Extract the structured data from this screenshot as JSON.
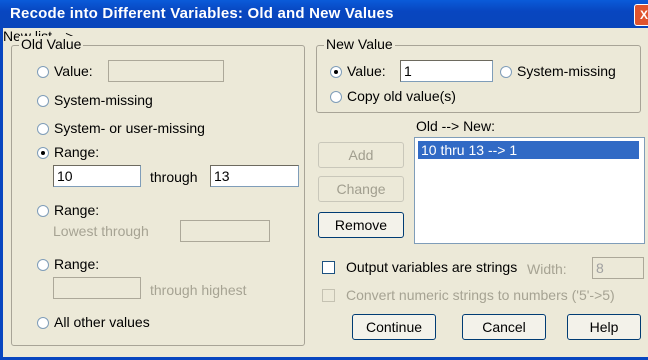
{
  "window": {
    "title": "Recode into Different Variables: Old and New Values",
    "close_glyph": "X"
  },
  "old_value": {
    "legend": "Old Value",
    "value_label": "Value:",
    "value_input": "",
    "system_missing_label": "System-missing",
    "system_or_user_missing_label": "System- or user-missing",
    "range_label": "Range:",
    "range_from": "10",
    "through_label": "through",
    "range_to": "13",
    "range_lowest_label": "Range:",
    "lowest_through_label": "Lowest through",
    "lowest_through_input": "",
    "range_highest_label": "Range:",
    "through_highest_input": "",
    "through_highest_label": "through highest",
    "all_other_values_label": "All other values",
    "selected_option": "range"
  },
  "new_value": {
    "legend": "New Value",
    "value_label": "Value:",
    "value_input": "1",
    "system_missing_label": "System-missing",
    "copy_old_label": "Copy old value(s)",
    "selected_option": "value"
  },
  "old_new": {
    "label": "Old --> New:",
    "items": [
      "10 thru 13 --> 1"
    ],
    "add_label": "Add",
    "change_label": "Change",
    "remove_label": "Remove"
  },
  "options": {
    "output_strings_label": "Output variables are strings",
    "width_label": "Width:",
    "width_value": "8",
    "convert_label": "Convert numeric strings to numbers ('5'->5)"
  },
  "buttons": {
    "continue_label": "Continue",
    "cancel_label": "Cancel",
    "help_label": "Help"
  }
}
